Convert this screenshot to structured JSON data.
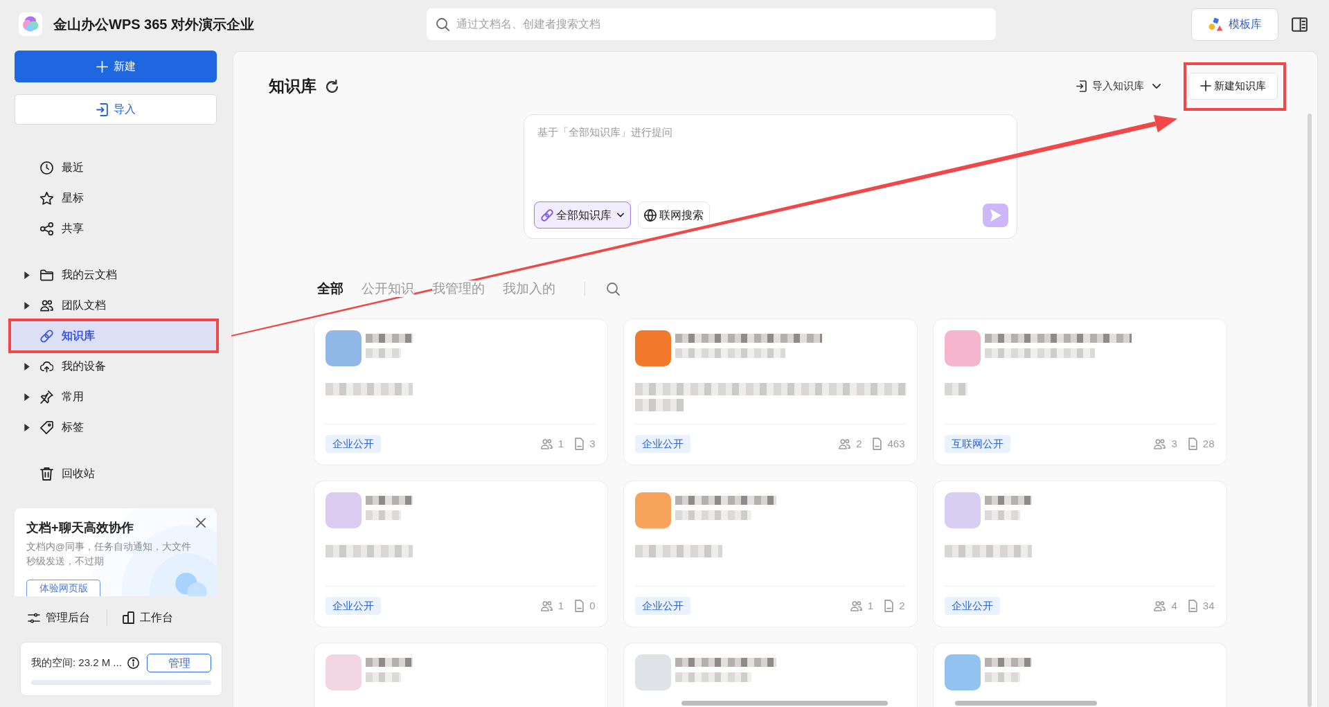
{
  "app": {
    "title": "金山办公WPS 365 对外演示企业"
  },
  "search": {
    "placeholder": "通过文档名、创建者搜索文档"
  },
  "template_button": {
    "label": "模板库"
  },
  "sidebar": {
    "new_button": "新建",
    "import_button": "导入",
    "groups": [
      [
        {
          "label": "最近",
          "expandable": false,
          "selected": false,
          "annotated": false
        },
        {
          "label": "星标",
          "expandable": false,
          "selected": false,
          "annotated": false
        },
        {
          "label": "共享",
          "expandable": false,
          "selected": false,
          "annotated": false
        }
      ],
      [
        {
          "label": "我的云文档",
          "expandable": true,
          "selected": false,
          "annotated": false
        },
        {
          "label": "团队文档",
          "expandable": true,
          "selected": false,
          "annotated": false
        },
        {
          "label": "知识库",
          "expandable": false,
          "selected": true,
          "annotated": true
        },
        {
          "label": "我的设备",
          "expandable": true,
          "selected": false,
          "annotated": false
        },
        {
          "label": "常用",
          "expandable": true,
          "selected": false,
          "annotated": false
        },
        {
          "label": "标签",
          "expandable": true,
          "selected": false,
          "annotated": false
        }
      ],
      [
        {
          "label": "回收站",
          "expandable": false,
          "selected": false,
          "annotated": false
        }
      ]
    ],
    "promo": {
      "title": "文档+聊天高效协作",
      "text": "文档内@同事，任务自动通知，大文件秒级发送，不过期",
      "button": "体验网页版"
    },
    "links": [
      "管理后台",
      "工作台"
    ],
    "storage": {
      "text": "我的空间: 23.2 M ...",
      "button": "管理"
    }
  },
  "main": {
    "title": "知识库",
    "import_menu": "导入知识库",
    "new_button": {
      "label": "新建知识库",
      "annotated": true
    },
    "ask": {
      "placeholder": "基于「全部知识库」进行提问",
      "scope_chip": "全部知识库",
      "web_chip": "联网搜索"
    },
    "tabs": [
      {
        "label": "全部",
        "selected": true
      },
      {
        "label": "公开知识",
        "selected": false
      },
      {
        "label": "我管理的",
        "selected": false
      },
      {
        "label": "我加入的",
        "selected": false
      }
    ],
    "cards": [
      {
        "color": "#8fb8e6",
        "tag": "企业公开",
        "members": "1",
        "documents": "3"
      },
      {
        "color": "#f2782c",
        "tag": "企业公开",
        "members": "2",
        "documents": "463"
      },
      {
        "color": "#f5b5cc",
        "tag": "互联网公开",
        "members": "3",
        "documents": "28"
      },
      {
        "color": "#dccbf0",
        "tag": "企业公开",
        "members": "1",
        "documents": "0"
      },
      {
        "color": "#f7a35c",
        "tag": "企业公开",
        "members": "1",
        "documents": "2"
      },
      {
        "color": "#d8cef2",
        "tag": "企业公开",
        "members": "4",
        "documents": "34"
      },
      {
        "color": "#f2d6e2"
      },
      {
        "color": "#dfe3e8"
      },
      {
        "color": "#92c3f0"
      }
    ]
  },
  "annotation_arrow": true
}
